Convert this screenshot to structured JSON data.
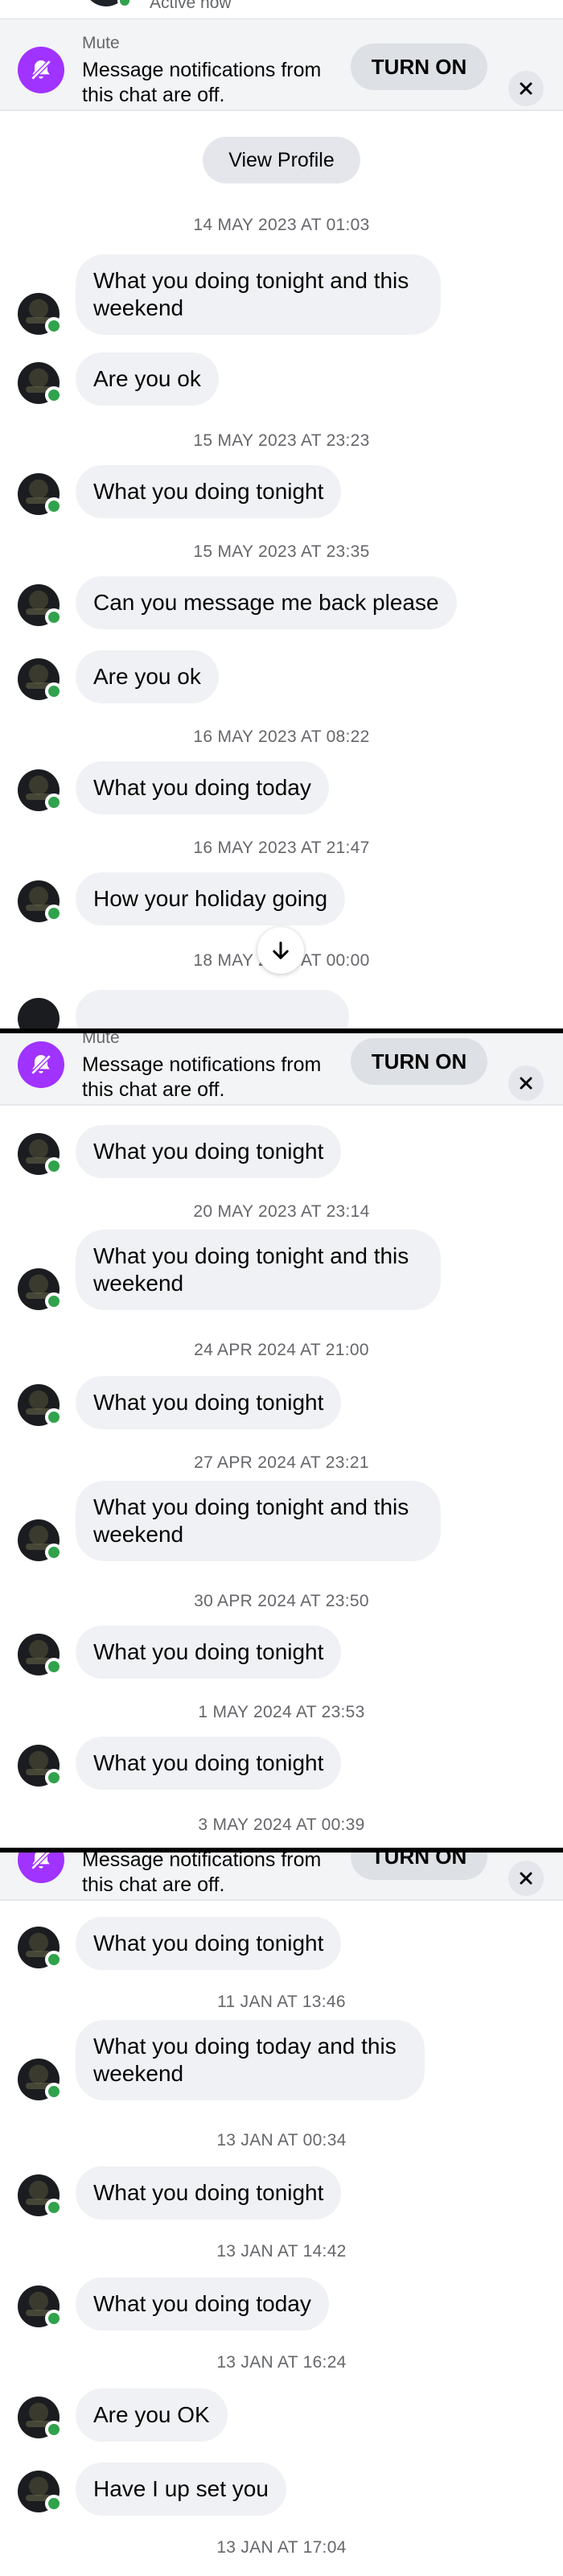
{
  "header": {
    "status_text": "Active now"
  },
  "mute_banner": {
    "title": "Mute",
    "text": "Message notifications from this chat are off.",
    "turn_on_label": "TURN ON",
    "icon": "bell-slash-icon",
    "accent_color": "#a033ff"
  },
  "view_profile_label": "View Profile",
  "scroll_down_icon": "arrow-down-icon",
  "screenshot_1": {
    "timestamps": [
      "14 MAY 2023 AT 01:03",
      "15 MAY 2023 AT 23:23",
      "15 MAY 2023 AT 23:35",
      "16 MAY 2023 AT 08:22",
      "16 MAY 2023 AT 21:47",
      "18 MAY 2023 AT 00:00"
    ],
    "messages": [
      "What you doing tonight and this weekend",
      "Are you ok",
      "What you doing tonight",
      "Can you message me back please",
      "Are you ok",
      "What you doing today",
      "How your holiday going"
    ]
  },
  "screenshot_2": {
    "timestamps": [
      "20 MAY 2023 AT 23:14",
      "24 APR 2024 AT 21:00",
      "27 APR 2024 AT 23:21",
      "30 APR 2024 AT 23:50",
      "1 MAY 2024 AT 23:53",
      "3 MAY 2024 AT 00:39"
    ],
    "messages": [
      "What you doing tonight",
      "What you doing tonight and this weekend",
      "What you doing tonight",
      "What you doing tonight and this weekend",
      "What you doing tonight",
      "What you doing tonight"
    ]
  },
  "screenshot_3": {
    "timestamps": [
      "11 JAN AT 13:46",
      "13 JAN AT 00:34",
      "13 JAN AT 14:42",
      "13 JAN AT 16:24",
      "13 JAN AT 17:04"
    ],
    "messages": [
      "What you doing tonight",
      "What you doing today and this weekend",
      "What you doing tonight",
      "What you doing today",
      "Are you OK",
      "Have I up set you"
    ]
  }
}
